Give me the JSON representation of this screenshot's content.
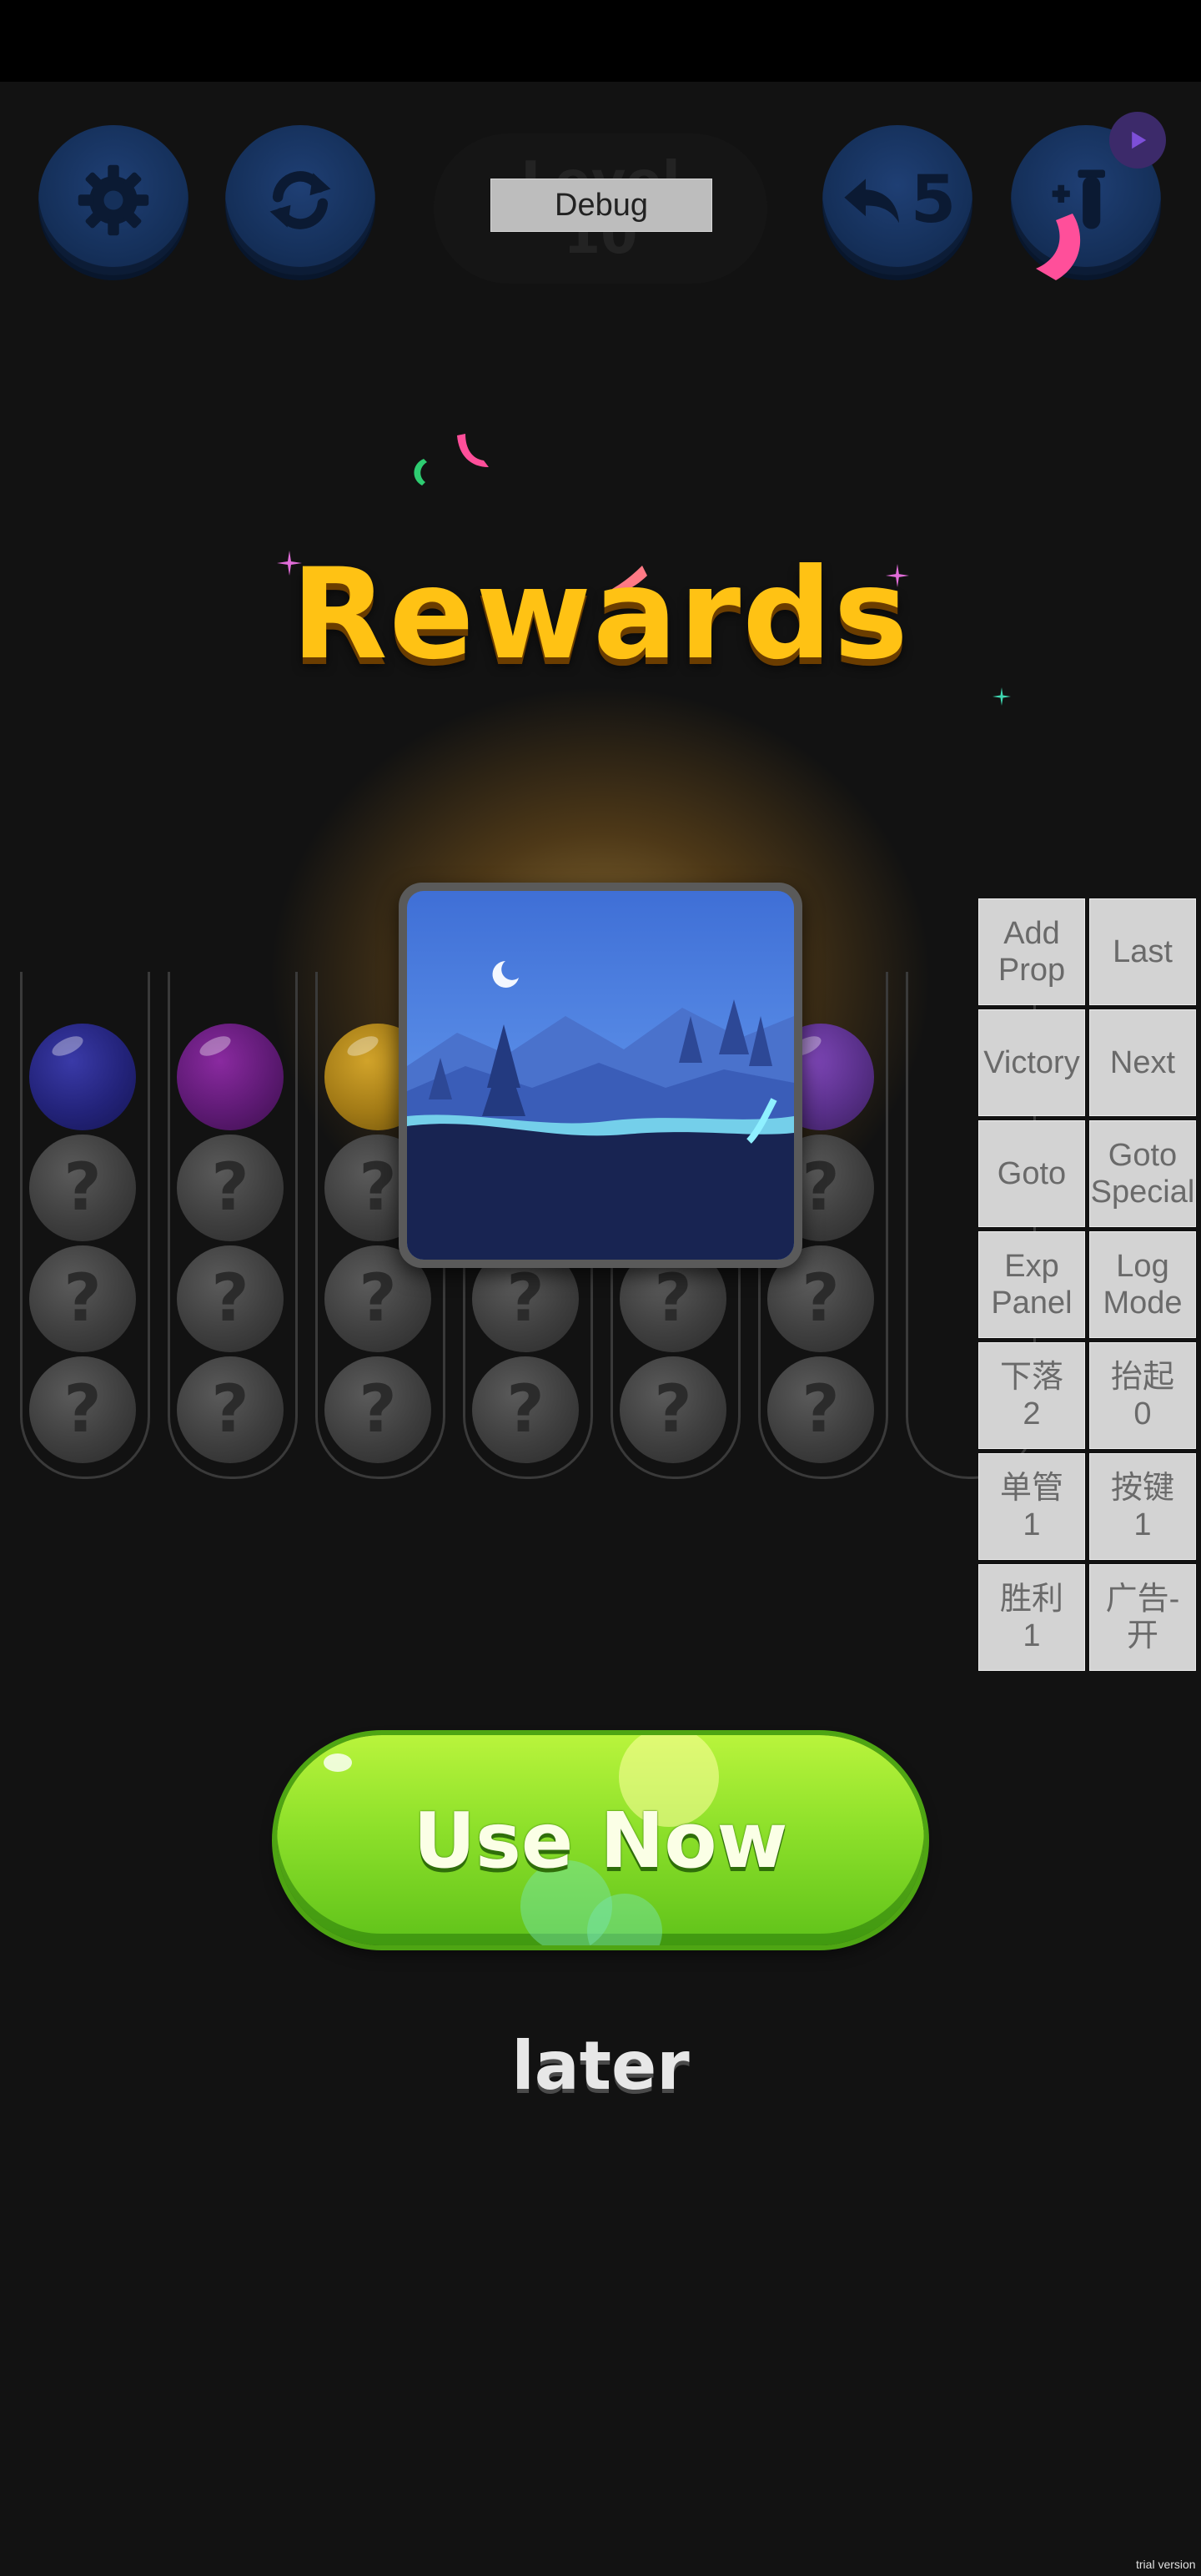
{
  "hud": {
    "settings_icon": "gear-icon",
    "restart_icon": "refresh-icon",
    "level_label": "Level",
    "level_number": "10",
    "debug_label": "Debug",
    "undo_icon": "undo-arrow-icon",
    "undo_count": "5",
    "add_tube_icon": "add-tube-icon",
    "video_badge_icon": "play-icon"
  },
  "rewards": {
    "title": "Rewards",
    "card_icon": "night-landscape-theme"
  },
  "tubes": [
    {
      "balls": [
        "navy",
        "?",
        "?",
        "?"
      ]
    },
    {
      "balls": [
        "purple",
        "?",
        "?",
        "?"
      ]
    },
    {
      "balls": [
        "gold",
        "?",
        "?",
        "?"
      ]
    },
    {
      "balls": [
        "hidden",
        "?",
        "?",
        "?"
      ]
    },
    {
      "balls": [
        "hidden",
        "?",
        "?",
        "?"
      ]
    },
    {
      "balls": [
        "violet",
        "?",
        "?",
        "?"
      ]
    },
    {
      "balls": []
    }
  ],
  "debug_panel": [
    [
      "Add\nProp",
      "Last"
    ],
    [
      "Victory",
      "Next"
    ],
    [
      "Goto",
      "Goto\nSpecial"
    ],
    [
      "Exp\nPanel",
      "Log\nMode"
    ],
    [
      "下落\n2",
      "抬起\n0"
    ],
    [
      "单管\n1",
      "按键\n1"
    ],
    [
      "胜利\n1",
      "广告-开"
    ]
  ],
  "actions": {
    "use_now": "Use Now",
    "later": "later"
  },
  "watermark": "trial version",
  "colors": {
    "title": "#ffc214",
    "use_now_green": "#8de02a",
    "hud_blue": "#15305a"
  }
}
